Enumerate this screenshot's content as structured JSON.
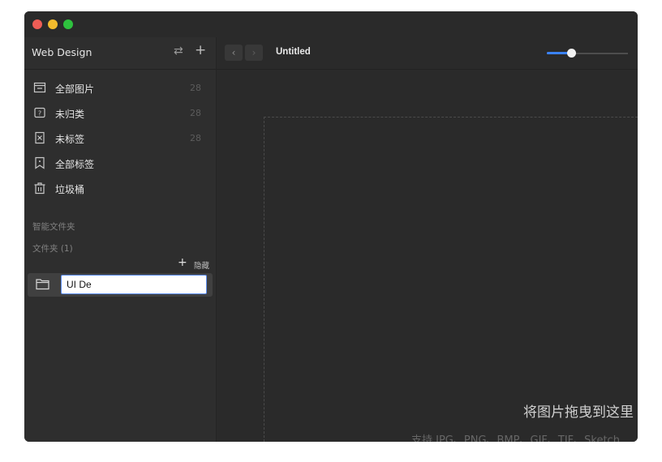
{
  "window": {
    "traffic_lights": {
      "close": "#ee5d56",
      "minimize": "#f2bb2d",
      "maximize": "#2ec13e"
    }
  },
  "sidebar": {
    "library_name": "Web Design",
    "items": [
      {
        "label": "全部图片",
        "count": "28",
        "icon": "all-images-icon"
      },
      {
        "label": "未归类",
        "count": "28",
        "icon": "uncategorized-icon"
      },
      {
        "label": "未标签",
        "count": "28",
        "icon": "untagged-icon"
      },
      {
        "label": "全部标签",
        "count": "",
        "icon": "all-tags-icon"
      },
      {
        "label": "垃圾桶",
        "count": "",
        "icon": "trash-icon"
      }
    ],
    "smart_folders_label": "智能文件夹",
    "folders_label": "文件夹 (1)",
    "folders_add": "+",
    "folders_hide_label": "隐藏",
    "new_folder_value": "UI De"
  },
  "toolbar": {
    "back": "‹",
    "forward": "›",
    "title": "Untitled",
    "zoom_level": 0.3,
    "accent": "#3b82f6"
  },
  "dropzone": {
    "title": "将图片拖曳到这里",
    "hint": "支持 JPG、PNG、BMP、GIF、TIF、Sketch"
  }
}
